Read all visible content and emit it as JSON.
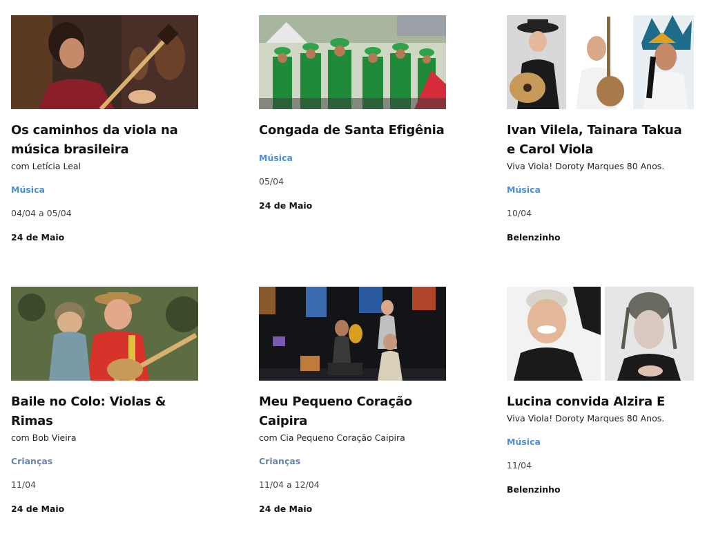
{
  "events": [
    {
      "title": "Os caminhos da viola na música brasileira",
      "subtitle": "com Letícia Leal",
      "category": "Música",
      "dates": "04/04 a 05/04",
      "place": "24 de Maio",
      "image": "woman-with-viola-photo"
    },
    {
      "title": "Congada de Santa Efigênia",
      "subtitle": "",
      "category": "Música",
      "dates": "05/04",
      "place": "24 de Maio",
      "image": "congada-parade-photo"
    },
    {
      "title": "Ivan Vilela, Tainara Takua e Carol Viola",
      "subtitle": "Viva Viola! Doroty Marques 80 Anos.",
      "category": "Música",
      "dates": "10/04",
      "place": "Belenzinho",
      "image": "three-musicians-photo"
    },
    {
      "title": "Baile no Colo: Violas & Rimas",
      "subtitle": "com Bob Vieira",
      "category": "Crianças",
      "dates": "11/04",
      "place": "24 de Maio",
      "image": "man-with-puppet-photo"
    },
    {
      "title": "Meu Pequeno Coração Caipira",
      "subtitle": "com Cia Pequeno Coração Caipira",
      "category": "Crianças",
      "dates": "11/04 a 12/04",
      "place": "24 de Maio",
      "image": "stage-performance-photo"
    },
    {
      "title": "Lucina convida Alzira E",
      "subtitle": "Viva Viola! Doroty Marques 80 Anos.",
      "category": "Música",
      "dates": "11/04",
      "place": "Belenzinho",
      "image": "two-singers-photo"
    }
  ]
}
